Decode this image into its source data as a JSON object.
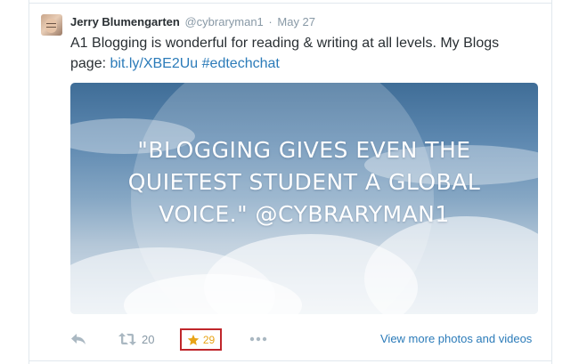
{
  "tweet": {
    "name": "Jerry Blumengarten",
    "handle": "@cybraryman1",
    "separator": "·",
    "time": "May 27",
    "text_line1": "A1 Blogging is wonderful for reading & writing at all levels. My Blogs",
    "text_line2_prefix": "page: ",
    "link": "bit.ly/XBE2Uu",
    "hashtag": "#edtechchat"
  },
  "media": {
    "quote_line1": "\"BLOGGING GIVES EVEN THE",
    "quote_line2": "QUIETEST STUDENT A GLOBAL",
    "quote_line3": "VOICE.\" @CYBRARYMAN1"
  },
  "actions": {
    "retweet_count": "20",
    "favorite_count": "29",
    "view_more": "View more photos and videos"
  },
  "icons": {
    "reply": "reply-icon",
    "retweet": "retweet-icon",
    "favorite": "star-icon",
    "more": "more-icon"
  },
  "colors": {
    "link": "#2b7bb9",
    "favorite_star": "#e8a317",
    "highlight_box": "#c0262b"
  }
}
